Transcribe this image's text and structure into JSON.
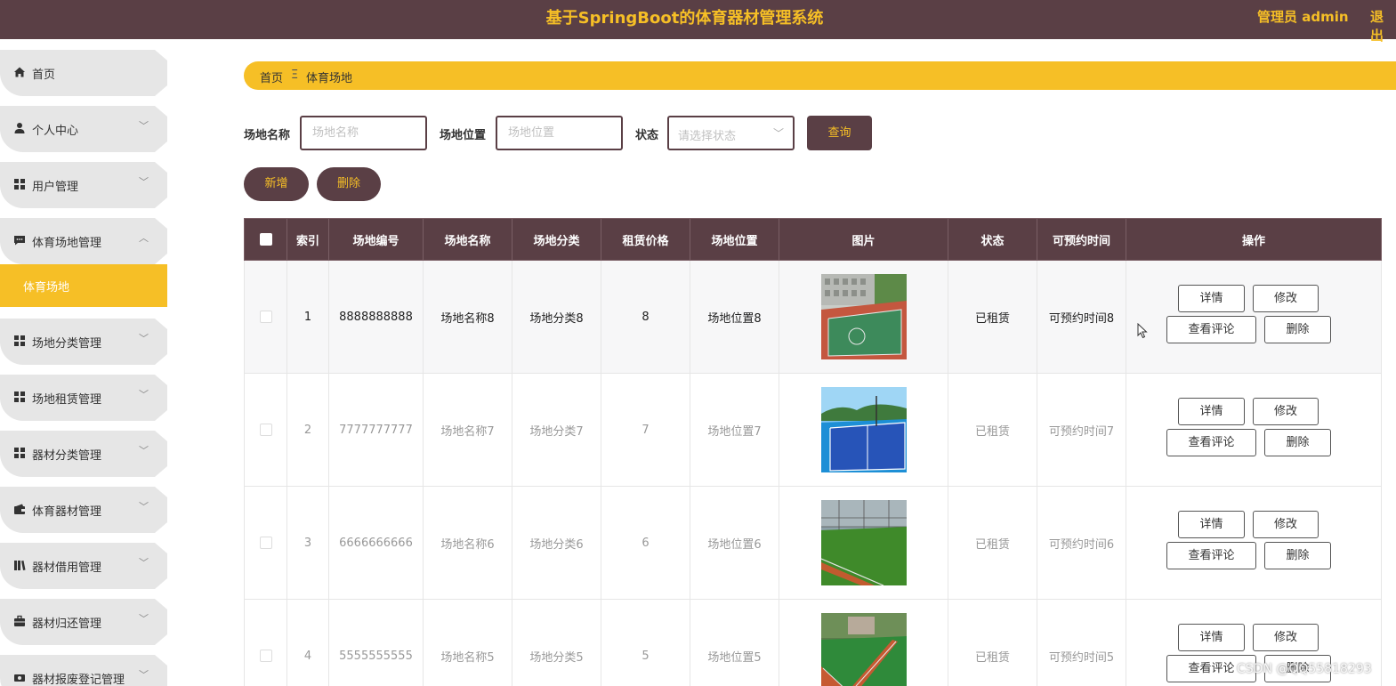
{
  "header": {
    "title": "基于SpringBoot的体育器材管理系统",
    "admin": "管理员 admin",
    "logout": "退出"
  },
  "sidebar": {
    "items": [
      {
        "label": "首页",
        "icon": "home-icon"
      },
      {
        "label": "个人中心",
        "icon": "user-icon"
      },
      {
        "label": "用户管理",
        "icon": "grid-icon"
      },
      {
        "label": "体育场地管理",
        "icon": "message-icon"
      },
      {
        "label": "场地分类管理",
        "icon": "grid-icon"
      },
      {
        "label": "场地租赁管理",
        "icon": "grid-icon"
      },
      {
        "label": "器材分类管理",
        "icon": "grid-icon"
      },
      {
        "label": "体育器材管理",
        "icon": "wallet-icon"
      },
      {
        "label": "器材借用管理",
        "icon": "books-icon"
      },
      {
        "label": "器材归还管理",
        "icon": "briefcase-icon"
      },
      {
        "label": "器材报废登记管理",
        "icon": "money-icon"
      }
    ],
    "active_sub": "体育场地"
  },
  "breadcrumb": {
    "home": "首页",
    "sep": "Ξ",
    "current": "体育场地"
  },
  "search": {
    "name_label": "场地名称",
    "name_placeholder": "场地名称",
    "location_label": "场地位置",
    "location_placeholder": "场地位置",
    "status_label": "状态",
    "status_placeholder": "请选择状态",
    "query_label": "查询"
  },
  "actions": {
    "add_label": "新增",
    "delete_label": "删除"
  },
  "table": {
    "columns": [
      "索引",
      "场地编号",
      "场地名称",
      "场地分类",
      "租赁价格",
      "场地位置",
      "图片",
      "状态",
      "可预约时间",
      "操作"
    ],
    "rows": [
      {
        "index": "1",
        "code": "8888888888",
        "name": "场地名称8",
        "category": "场地分类8",
        "price": "8",
        "location": "场地位置8",
        "status": "已租赁",
        "time": "可预约时间8"
      },
      {
        "index": "2",
        "code": "7777777777",
        "name": "场地名称7",
        "category": "场地分类7",
        "price": "7",
        "location": "场地位置7",
        "status": "已租赁",
        "time": "可预约时间7"
      },
      {
        "index": "3",
        "code": "6666666666",
        "name": "场地名称6",
        "category": "场地分类6",
        "price": "6",
        "location": "场地位置6",
        "status": "已租赁",
        "time": "可预约时间6"
      },
      {
        "index": "4",
        "code": "5555555555",
        "name": "场地名称5",
        "category": "场地分类5",
        "price": "5",
        "location": "场地位置5",
        "status": "已租赁",
        "time": "可预约时间5"
      }
    ],
    "ops": {
      "detail": "详情",
      "edit": "修改",
      "comments": "查看评论",
      "delete": "删除"
    }
  },
  "watermark": "CSDN @QQ55818293",
  "colors": {
    "primary": "#5a3f45",
    "accent": "#f6bf26",
    "menu_bg": "#e6e6e6"
  }
}
